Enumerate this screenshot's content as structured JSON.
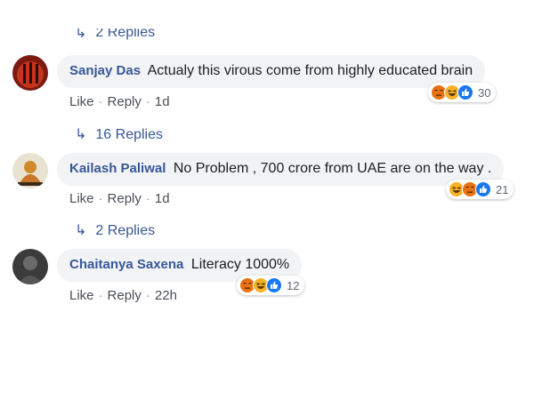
{
  "top_replies": {
    "label": "2 Replies"
  },
  "comments": [
    {
      "author": "Sanjay Das",
      "text": "Actualy this virous come from highly educated brain",
      "like_label": "Like",
      "reply_label": "Reply",
      "time": "1d",
      "reaction_icons": [
        "angry-icon",
        "haha-icon",
        "like-icon"
      ],
      "reaction_count": "30",
      "replies_label": "16 Replies"
    },
    {
      "author": "Kailash Paliwal",
      "text": "No Problem , 700 crore from UAE are on the way .",
      "like_label": "Like",
      "reply_label": "Reply",
      "time": "1d",
      "reaction_icons": [
        "haha-icon",
        "angry-icon",
        "like-icon"
      ],
      "reaction_count": "21",
      "replies_label": "2 Replies"
    },
    {
      "author": "Chaitanya Saxena",
      "text": "Literacy 1000%",
      "like_label": "Like",
      "reply_label": "Reply",
      "time": "22h",
      "reaction_icons": [
        "angry-icon",
        "haha-icon",
        "like-icon"
      ],
      "reaction_count": "12"
    }
  ],
  "colors": {
    "link_blue": "#385898",
    "bubble_bg": "#f2f3f5",
    "meta_gray": "#606770",
    "angry": "#e9710f",
    "haha": "#f7b125",
    "like": "#1877f2"
  }
}
